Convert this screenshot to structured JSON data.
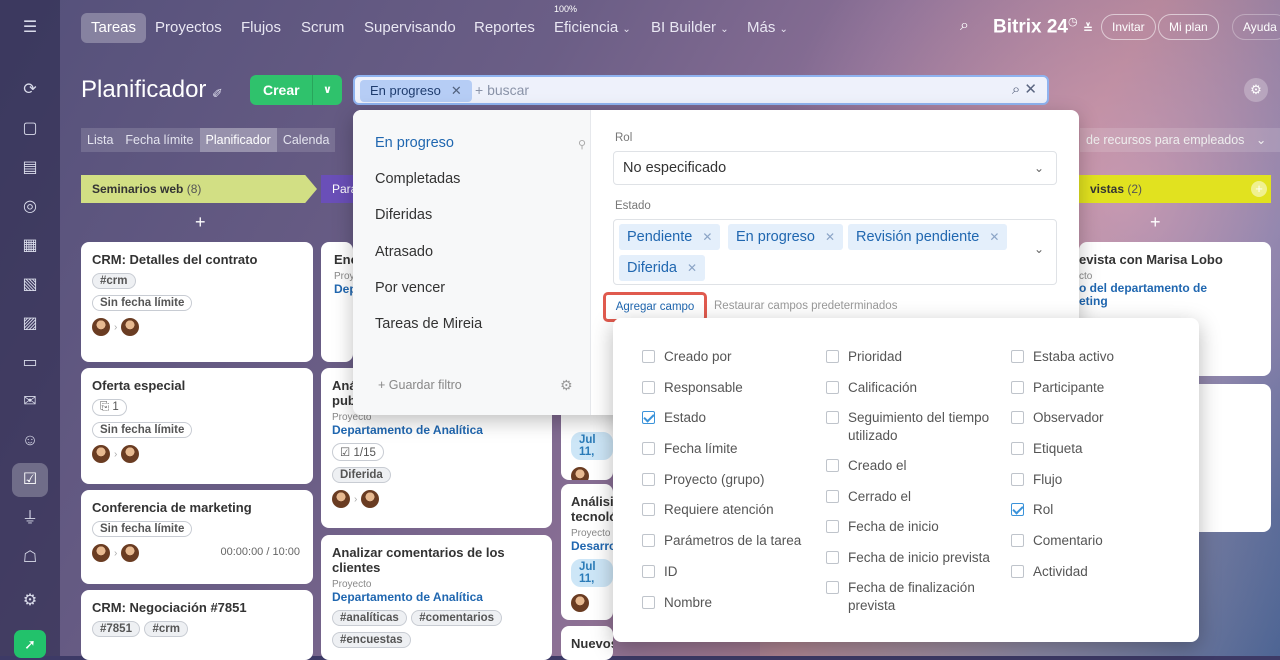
{
  "nav": {
    "tabs": [
      "Tareas",
      "Proyectos",
      "Flujos",
      "Scrum",
      "Supervisando",
      "Reportes",
      "Eficiencia",
      "BI Builder",
      "Más"
    ],
    "efficiency_badge": "100%",
    "brand": "Bitrix 24",
    "invite": "Invitar",
    "my_plan": "Mi plan",
    "help": "Ayuda"
  },
  "page": {
    "title": "Planificador",
    "create": "Crear"
  },
  "search": {
    "tag": "En progreso",
    "placeholder": "+ buscar"
  },
  "views": [
    "Lista",
    "Fecha límite",
    "Planificador",
    "Calenda"
  ],
  "resources_view": "de recursos para empleados",
  "columns": [
    {
      "name": "Seminarios web",
      "count": "(8)"
    },
    {
      "name": "Para",
      "count": ""
    },
    {
      "name": "vistas",
      "count": "(2)"
    }
  ],
  "cards": {
    "c1": {
      "title": "CRM: Detalles del contrato",
      "tag": "#crm",
      "deadline": "Sin fecha límite"
    },
    "c2": {
      "title": "Oferta especial",
      "files": "1",
      "deadline": "Sin fecha límite"
    },
    "c3": {
      "title": "Conferencia de marketing",
      "deadline": "Sin fecha límite",
      "time": "00:00:00 / 10:00"
    },
    "c4": {
      "title": "CRM: Negociación #7851",
      "tag1": "#7851",
      "tag2": "#crm"
    },
    "c5": {
      "title": "Anál\npub",
      "proj": "Proyecto",
      "dept": "Departamento de Analítica",
      "checklist": "1/15",
      "status": "Diferida"
    },
    "c6": {
      "title": "Analizar comentarios de los clientes",
      "proj": "Proyecto",
      "dept": "Departamento de Analítica",
      "tag1": "#analíticas",
      "tag2": "#comentarios",
      "tag3": "#encuestas"
    },
    "c7": {
      "title": "Análisis tecnoló",
      "proj": "Proyecto",
      "dept": "Desarro",
      "date": "Jul 11,"
    },
    "c8": {
      "date": "Jul 11,"
    },
    "c9": {
      "title": "Nuevos landings"
    },
    "c10": {
      "title": "evista con Marisa Lobo",
      "proj": "cto",
      "dept": "o del departamento de\neting"
    },
    "c11": {
      "title": "Enc",
      "proj": "Proy",
      "dept": "Dep",
      "chip": "Sin"
    }
  },
  "filter": {
    "presets": [
      "En progreso",
      "Completadas",
      "Diferidas",
      "Atrasado",
      "Por vencer",
      "Tareas de Mireia"
    ],
    "save": "+ Guardar filtro",
    "role_label": "Rol",
    "role_value": "No especificado",
    "status_label": "Estado",
    "status_values": [
      "Pendiente",
      "En progreso",
      "Revisión pendiente",
      "Diferida"
    ],
    "add_field": "Agregar campo",
    "restore": "Restaurar campos predeterminados"
  },
  "fields": {
    "col1": [
      {
        "label": "Creado por",
        "checked": false
      },
      {
        "label": "Responsable",
        "checked": false
      },
      {
        "label": "Estado",
        "checked": true
      },
      {
        "label": "Fecha límite",
        "checked": false
      },
      {
        "label": "Proyecto (grupo)",
        "checked": false
      },
      {
        "label": "Requiere atención",
        "checked": false
      },
      {
        "label": "Parámetros de la tarea",
        "checked": false
      },
      {
        "label": "ID",
        "checked": false
      },
      {
        "label": "Nombre",
        "checked": false
      }
    ],
    "col2": [
      {
        "label": "Prioridad",
        "checked": false
      },
      {
        "label": "Calificación",
        "checked": false
      },
      {
        "label": "Seguimiento del tiempo utilizado",
        "checked": false
      },
      {
        "label": "Creado el",
        "checked": false
      },
      {
        "label": "Cerrado el",
        "checked": false
      },
      {
        "label": "Fecha de inicio",
        "checked": false
      },
      {
        "label": "Fecha de inicio prevista",
        "checked": false
      },
      {
        "label": "Fecha de finalización prevista",
        "checked": false
      }
    ],
    "col3": [
      {
        "label": "Estaba activo",
        "checked": false
      },
      {
        "label": "Participante",
        "checked": false
      },
      {
        "label": "Observador",
        "checked": false
      },
      {
        "label": "Etiqueta",
        "checked": false
      },
      {
        "label": "Flujo",
        "checked": false
      },
      {
        "label": "Rol",
        "checked": true
      },
      {
        "label": "Comentario",
        "checked": false
      },
      {
        "label": "Actividad",
        "checked": false
      }
    ]
  }
}
